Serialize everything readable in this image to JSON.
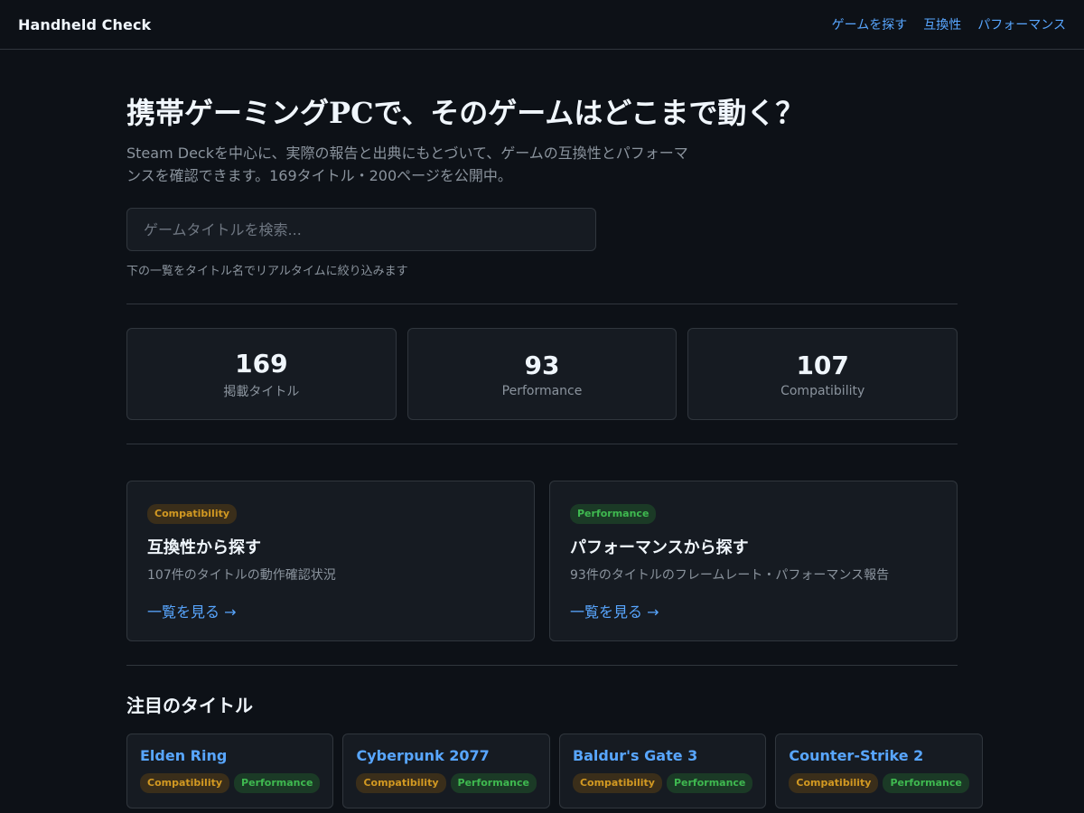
{
  "header": {
    "brand": "Handheld Check",
    "nav": [
      "ゲームを探す",
      "互換性",
      "パフォーマンス"
    ]
  },
  "hero": {
    "title": "携帯ゲーミングPCで、そのゲームはどこまで動く？",
    "subtitle": "Steam Deckを中心に、実際の報告と出典にもとづいて、ゲームの互換性とパフォーマンスを確認できます。169タイトル・200ページを公開中。",
    "search_placeholder": "ゲームタイトルを検索...",
    "search_hint": "下の一覧をタイトル名でリアルタイムに絞り込みます"
  },
  "stats": [
    {
      "value": "169",
      "label": "掲載タイトル"
    },
    {
      "value": "93",
      "label": "Performance"
    },
    {
      "value": "107",
      "label": "Compatibility"
    }
  ],
  "categories": [
    {
      "badge": "Compatibility",
      "title": "互換性から探す",
      "desc": "107件のタイトルの動作確認状況",
      "link": "一覧を見る →"
    },
    {
      "badge": "Performance",
      "title": "パフォーマンスから探す",
      "desc": "93件のタイトルのフレームレート・パフォーマンス報告",
      "link": "一覧を見る →"
    }
  ],
  "featured": {
    "title": "注目のタイトル",
    "games": [
      {
        "name": "Elden Ring",
        "badges": [
          "Compatibility",
          "Performance"
        ]
      },
      {
        "name": "Cyberpunk 2077",
        "badges": [
          "Compatibility",
          "Performance"
        ]
      },
      {
        "name": "Baldur's Gate 3",
        "badges": [
          "Compatibility",
          "Performance"
        ]
      },
      {
        "name": "Counter-Strike 2",
        "badges": [
          "Compatibility",
          "Performance"
        ]
      }
    ]
  },
  "colors": {
    "background": "#0d1117",
    "accent": "#58a6ff",
    "compat_badge": "#d29922",
    "perf_badge": "#3fb950"
  }
}
